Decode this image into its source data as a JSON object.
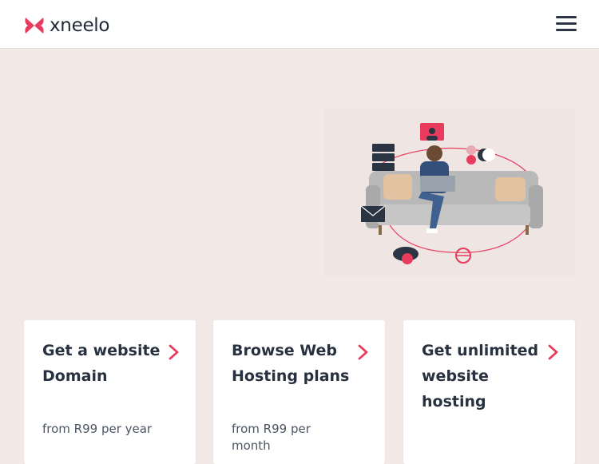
{
  "header": {
    "brand": "xneelo",
    "brand_color": "#e83b5d",
    "menu_icon": "hamburger-menu-icon"
  },
  "hero": {
    "illustration": "person-on-sofa-with-laptop-illustration"
  },
  "cards": [
    {
      "title": "Get a website Domain",
      "subtitle": "from R99 per year"
    },
    {
      "title": "Browse Web Hosting plans",
      "subtitle": "from R99 per month"
    },
    {
      "title": "Get unlimited website hosting",
      "subtitle": ""
    }
  ],
  "colors": {
    "page_bg": "#f3e9e6",
    "accent": "#e83b5d",
    "text_dark": "#28313f"
  }
}
